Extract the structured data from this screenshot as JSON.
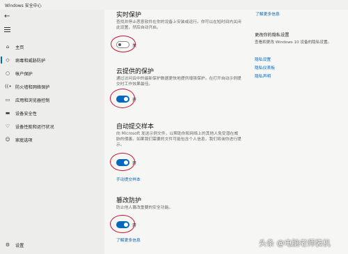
{
  "window": {
    "title": "Windows 安全中心"
  },
  "sidebar": {
    "items": [
      {
        "label": "主页",
        "icon": "home-icon"
      },
      {
        "label": "病毒和威胁防护",
        "icon": "shield-icon"
      },
      {
        "label": "帐户保护",
        "icon": "person-icon"
      },
      {
        "label": "防火墙和网络保护",
        "icon": "wifi-icon"
      },
      {
        "label": "应用和浏览器控制",
        "icon": "app-window-icon"
      },
      {
        "label": "设备安全性",
        "icon": "laptop-icon"
      },
      {
        "label": "设备性能和运行状况",
        "icon": "heart-icon"
      },
      {
        "label": "家庭选项",
        "icon": "family-icon"
      }
    ],
    "settings_label": "设置"
  },
  "main": {
    "top_link": "了解更多信息",
    "realtime": {
      "title": "实时保护",
      "desc": "查找并停止恶意软件在你的设备上安装或运行。你可以在短时间内关闭此设置，然后自动开启。",
      "state": "关"
    },
    "cloud": {
      "title": "云提供的保护",
      "desc": "通过访问云中的最新保护数据更快地提供增强保护。在打开自动示例提交时工作效果最佳。",
      "state": "开"
    },
    "sample": {
      "title": "自动提交样本",
      "desc": "向 Microsoft 发送示例文件，以帮助你和网络上的其他人免受潜在威胁的侵害。如果我们需要的文件可能包含个人信息，我们将询你进行提示。",
      "state": "开",
      "link": "手动提交样本"
    },
    "tamper": {
      "title": "篡改防护",
      "desc": "防止他人篡改重要的安全功能。",
      "state": "开",
      "link": "了解更多信息"
    }
  },
  "right": {
    "privacy_title": "更改你的隐私设置",
    "privacy_text": "查看和更改 Windows 10 设备的隐私设置。",
    "links": [
      "隐私设置",
      "隐私仪表板",
      "隐私声明"
    ]
  },
  "watermark": "头条 @电脑老师装机",
  "colors": {
    "accent": "#0067c0",
    "annotation": "#c8102e"
  }
}
